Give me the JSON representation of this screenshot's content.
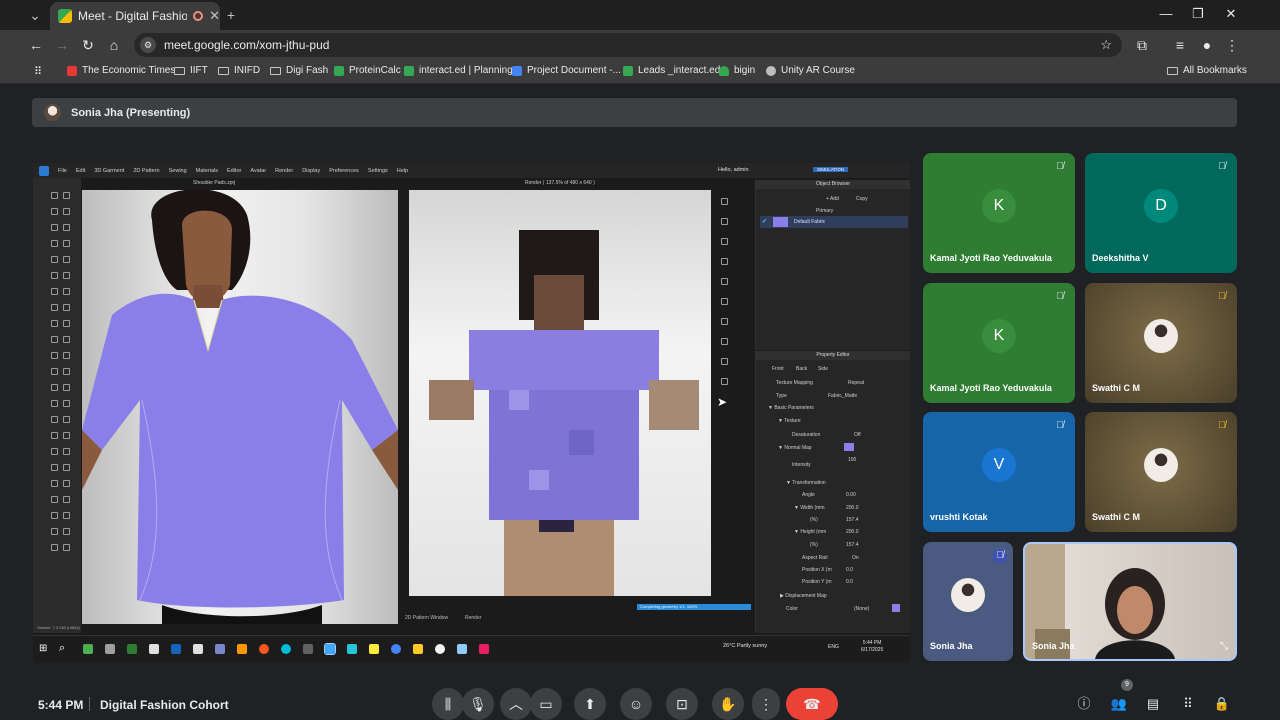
{
  "browser": {
    "tab_title": "Meet - Digital Fashion Coho",
    "new_tab": "+",
    "url": "meet.google.com/xom-jthu-pud",
    "bookmarks": [
      {
        "label": "The Economic Times",
        "color": "#e53935"
      },
      {
        "label": "IIFT",
        "color": ""
      },
      {
        "label": "INIFD",
        "color": ""
      },
      {
        "label": "Digi Fash",
        "color": ""
      },
      {
        "label": "ProteinCalc",
        "color": "#34a853"
      },
      {
        "label": "interact.ed | Planning",
        "color": "#34a853"
      },
      {
        "label": "Project Document -...",
        "color": "#4285f4"
      },
      {
        "label": "Leads _interact.ed",
        "color": "#34a853"
      },
      {
        "label": "bigin",
        "color": "#34a853"
      },
      {
        "label": "Unity AR Course",
        "color": "#bdbdbd"
      }
    ],
    "all_bookmarks": "All Bookmarks"
  },
  "presenter": {
    "label": "Sonia Jha (Presenting)"
  },
  "shared_app": {
    "menu": [
      "File",
      "Edit",
      "3D Garment",
      "2D Pattern",
      "Sewing",
      "Materials",
      "Editor",
      "Avatar",
      "Render",
      "Display",
      "Preferences",
      "Settings",
      "Help"
    ],
    "hello": "Hello, admin",
    "view3d_label": "Shoulder Pads.zprj",
    "view2d_label": "Render ( 137.5% of 480 x 640 )",
    "object_browser": "Object Browser",
    "simulation": "SIMULATION",
    "add": "+ Add",
    "copy": "Copy",
    "primary": "Primary",
    "fabric": "Default Fabric",
    "property_editor": "Property Editor",
    "prop_tabs": [
      "Front",
      "Back",
      "Side"
    ],
    "props": [
      {
        "label": "Texture Mapping",
        "value": "Repeat"
      },
      {
        "label": "Type",
        "value": "Fabric_Matte"
      },
      {
        "label": "▼ Basic Parameters",
        "value": ""
      },
      {
        "label": "▼ Texture",
        "value": ""
      },
      {
        "label": "Desaturation",
        "value": "Off"
      },
      {
        "label": "▼ Normal Map",
        "value": ""
      },
      {
        "label": "Intensity",
        "value": "100"
      },
      {
        "label": "▼ Transformation",
        "value": ""
      },
      {
        "label": "Angle",
        "value": "0.00"
      },
      {
        "label": "▼ Width (mm",
        "value": "200.0"
      },
      {
        "label": "(%)",
        "value": "157.4"
      },
      {
        "label": "▼ Height (mm",
        "value": "200.0"
      },
      {
        "label": "(%)",
        "value": "157.4"
      },
      {
        "label": "Aspect Rati",
        "value": "On"
      },
      {
        "label": "Position X (m",
        "value": "0.0"
      },
      {
        "label": "Position Y (m",
        "value": "0.0"
      },
      {
        "label": "▶ Displacement Map",
        "value": ""
      },
      {
        "label": "Color",
        "value": "(None)"
      }
    ],
    "sim_status": "Completing geometry 1/1, 100%",
    "bottom_tabs": [
      "2D Pattern Window",
      "Render"
    ],
    "version": "Version: 7.3.240 (r4664)",
    "weather": "26°C  Partly sunny",
    "lang": "ENG",
    "clock_time": "5:44 PM",
    "clock_date": "6/17/2025"
  },
  "participants": [
    {
      "name": "Kamal Jyoti Rao Yeduvakula",
      "initial": "K",
      "bg": "#2e7d32",
      "avatar_bg": "#388e3c"
    },
    {
      "name": "Deekshitha V",
      "initial": "D",
      "bg": "#00695c",
      "avatar_bg": "#00897b"
    },
    {
      "name": "Kamal Jyoti Rao Yeduvakula",
      "initial": "K",
      "bg": "#2e7d32",
      "avatar_bg": "#388e3c"
    },
    {
      "name": "Swathi C M",
      "initial": "",
      "bg": "#6d5f3a",
      "avatar_bg": ""
    },
    {
      "name": "vrushti Kotak",
      "initial": "V",
      "bg": "#1565a8",
      "avatar_bg": "#1976d2"
    },
    {
      "name": "Swathi C M",
      "initial": "",
      "bg": "#6d5f3a",
      "avatar_bg": ""
    },
    {
      "name": "Sonia Jha",
      "initial": "",
      "bg": "#4a5a80",
      "avatar_bg": ""
    },
    {
      "name": "Sonia Jha",
      "initial": "",
      "bg": "#c9c0b8",
      "avatar_bg": ""
    }
  ],
  "meeting": {
    "time": "5:44 PM",
    "name": "Digital Fashion Cohort",
    "people_count": "9"
  }
}
